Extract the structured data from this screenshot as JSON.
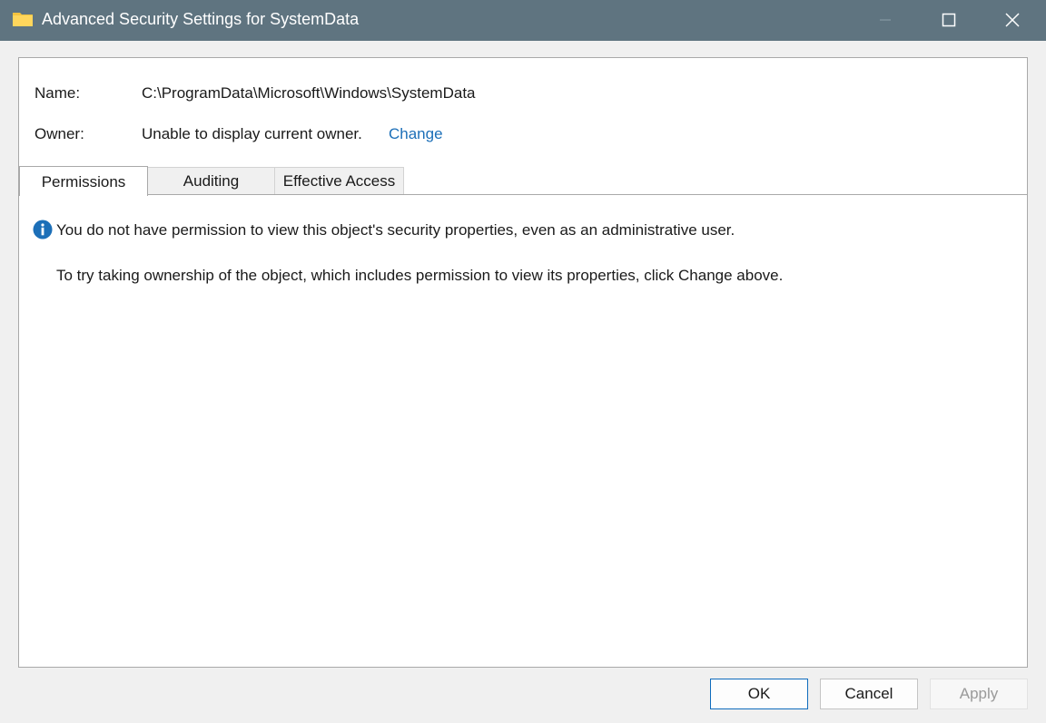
{
  "window": {
    "title": "Advanced Security Settings for SystemData",
    "accent_color": "#5f7480"
  },
  "details": {
    "name_label": "Name:",
    "name_value": "C:\\ProgramData\\Microsoft\\Windows\\SystemData",
    "owner_label": "Owner:",
    "owner_value": "Unable to display current owner.",
    "owner_change_link": "Change",
    "link_color": "#1c6fb8"
  },
  "tabs": [
    {
      "label": "Permissions",
      "active": true
    },
    {
      "label": "Auditing",
      "active": false
    },
    {
      "label": "Effective Access",
      "active": false
    }
  ],
  "content": {
    "info_icon": "info-icon",
    "message_primary": "You do not have permission to view this object's security properties, even as an administrative user.",
    "message_secondary": "To try taking ownership of the object, which includes permission to view its properties, click Change above."
  },
  "buttons": {
    "ok": "OK",
    "cancel": "Cancel",
    "apply": "Apply"
  }
}
